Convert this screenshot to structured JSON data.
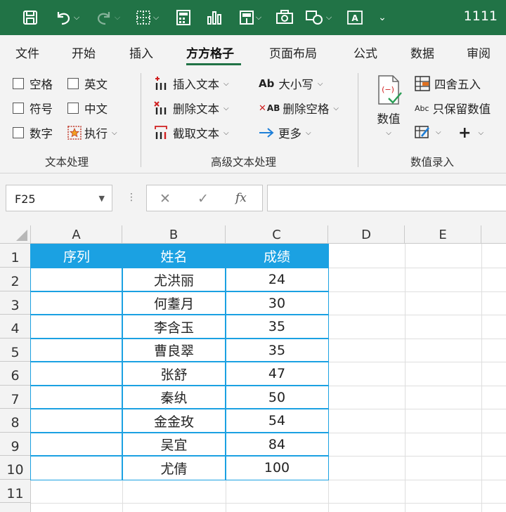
{
  "titlebar": {
    "count_text": "1111",
    "icons": [
      "save-icon",
      "undo-icon",
      "redo-icon",
      "borders-icon",
      "calculator-icon",
      "bar-chart-icon",
      "merge-cells-icon",
      "camera-icon",
      "shapes-icon",
      "textbox-icon",
      "customize-icon"
    ]
  },
  "tabs": [
    "文件",
    "开始",
    "插入",
    "方方格子",
    "页面布局",
    "公式",
    "数据",
    "审阅"
  ],
  "active_tab": "方方格子",
  "ribbon": {
    "text_group": {
      "label": "文本处理",
      "checks": [
        "空格",
        "英文",
        "符号",
        "中文",
        "数字"
      ],
      "execute": "执行"
    },
    "advanced_group": {
      "label": "高级文本处理",
      "insert_text": "插入文本",
      "delete_text": "删除文本",
      "extract_text": "截取文本",
      "case": "大小写",
      "case_icon_text": "Ab",
      "delete_space": "删除空格",
      "delete_space_icon_text": "AB",
      "more": "更多"
    },
    "number_group": {
      "label": "数值录入",
      "number_btn": "数值",
      "round": "四舍五入",
      "keep_number": "只保留数值",
      "keep_icon_text": "Abc"
    }
  },
  "formula_bar": {
    "name_box": "F25",
    "fx": "fx",
    "cancel": "✕",
    "confirm": "✓",
    "dots": "⋮",
    "value": ""
  },
  "sheet": {
    "columns": [
      "A",
      "B",
      "C",
      "D",
      "E"
    ],
    "rows": [
      "1",
      "2",
      "3",
      "4",
      "5",
      "6",
      "7",
      "8",
      "9",
      "10",
      "11"
    ],
    "header": [
      "序列",
      "姓名",
      "成绩"
    ],
    "data": [
      {
        "name": "尤洪丽",
        "score": "24"
      },
      {
        "name": "何耋月",
        "score": "30"
      },
      {
        "name": "李含玉",
        "score": "35"
      },
      {
        "name": "曹良翠",
        "score": "35"
      },
      {
        "name": "张舒",
        "score": "47"
      },
      {
        "name": "秦纨",
        "score": "50"
      },
      {
        "name": "金金玫",
        "score": "54"
      },
      {
        "name": "吴宜",
        "score": "84"
      },
      {
        "name": "尤倩",
        "score": "100"
      }
    ]
  },
  "colors": {
    "excel_green": "#217346",
    "table_header": "#1ba1e2"
  }
}
